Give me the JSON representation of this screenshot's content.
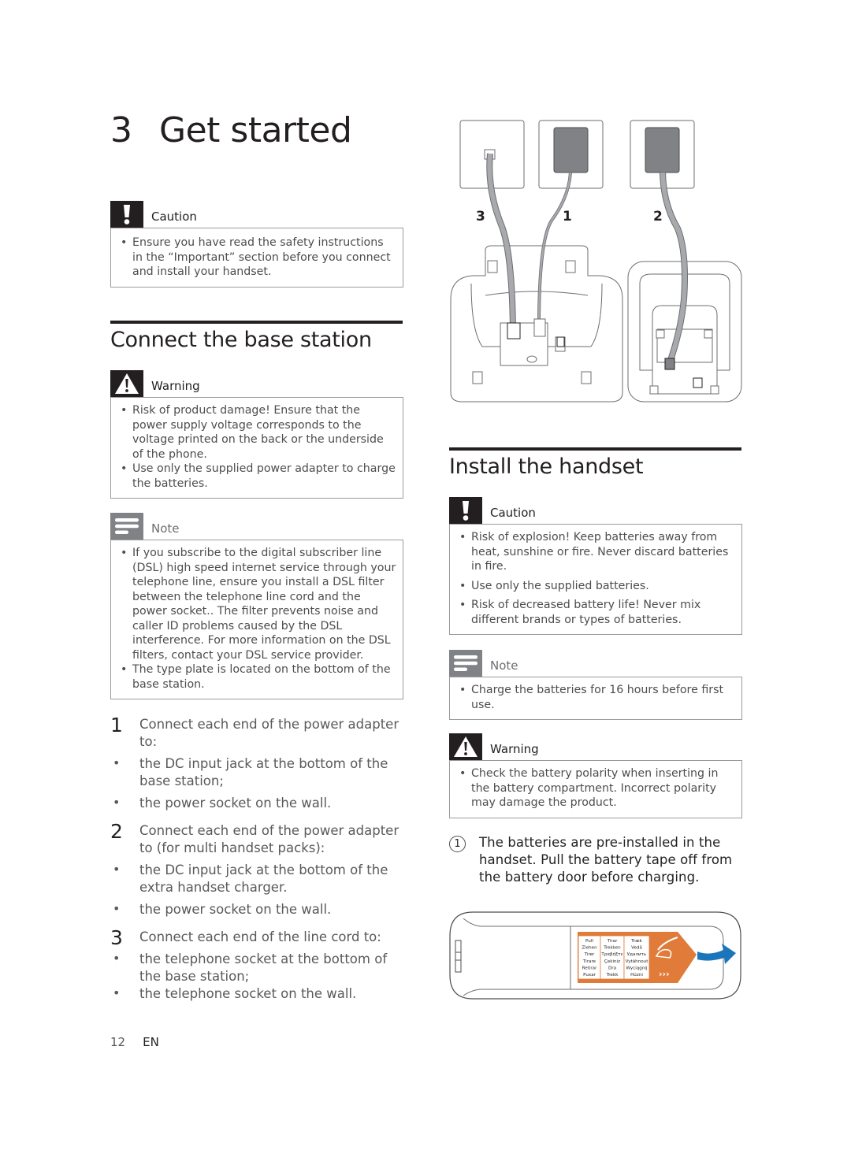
{
  "page": {
    "chapter_number": "3",
    "chapter_title": "Get started",
    "footer": {
      "page_number": "12",
      "language": "EN"
    }
  },
  "left_column": {
    "intro_caution": {
      "label": "Caution",
      "icon": "exclamation-icon",
      "items": [
        "Ensure you have read the safety instructions in the “Important” section before you connect and install your handset."
      ]
    },
    "section": {
      "title": "Connect the base station",
      "warning": {
        "label": "Warning",
        "icon": "warning-triangle-icon",
        "items": [
          "Risk of product damage! Ensure that the power supply voltage corresponds to the voltage printed on the back or the underside of the phone.",
          "Use only the supplied power adapter to charge the batteries."
        ]
      },
      "note": {
        "label": "Note",
        "icon": "note-lines-icon",
        "items": [
          "If you subscribe to the digital subscriber line (DSL) high speed internet service through your telephone line, ensure you install a DSL filter between the telephone line cord and the power socket.. The filter prevents noise and caller ID problems caused by the DSL interference. For more information on the DSL filters, contact your DSL service provider.",
          "The type plate is located on the bottom of the base station."
        ]
      },
      "steps": [
        {
          "number": "1",
          "text": "Connect each end of the power adapter to:",
          "bullets": [
            "the DC input jack at the bottom of the base station;",
            "the power socket on the wall."
          ]
        },
        {
          "number": "2",
          "text": "Connect each end of the power adapter to (for multi handset packs):",
          "bullets": [
            "the DC input jack at the bottom of the extra handset charger.",
            "the power socket on the wall."
          ]
        },
        {
          "number": "3",
          "text": "Connect each end of the line cord to:",
          "bullets": [
            "the telephone socket at the bottom of the base station;",
            "the telephone socket on the wall."
          ]
        }
      ]
    }
  },
  "right_column": {
    "connection_figure": {
      "labels": [
        "3",
        "1",
        "2"
      ],
      "description": "Wall sockets connected by cords to base station and charger"
    },
    "section": {
      "title": "Install the handset",
      "caution": {
        "label": "Caution",
        "icon": "exclamation-icon",
        "items": [
          "Risk of explosion! Keep batteries away from heat, sunshine or fire. Never discard batteries in fire.",
          "Use only the supplied batteries.",
          "Risk of decreased battery life! Never mix different brands or types of batteries."
        ]
      },
      "note": {
        "label": "Note",
        "icon": "note-lines-icon",
        "items": [
          "Charge the batteries for 16 hours before first use."
        ]
      },
      "warning": {
        "label": "Warning",
        "icon": "warning-triangle-icon",
        "items": [
          "Check the battery polarity when inserting in the battery compartment. Incorrect polarity may damage the product."
        ]
      },
      "step": {
        "number": "1",
        "text": "The batteries are pre-installed in the handset. Pull the battery tape off from the battery door before charging."
      },
      "battery_figure": {
        "tape_columns": [
          [
            "Pull",
            "Ziehen",
            "Tirer",
            "Tirare",
            "Retirar",
            "Puxar"
          ],
          [
            "Tirar",
            "Trekken",
            "Τραβήξτε",
            "Çekiniz",
            "Dra",
            "Trekk"
          ],
          [
            "Træk",
            "Vedä",
            "Удалить",
            "Vytáhnout",
            "Wyciągnij",
            "Húzni"
          ]
        ],
        "tape_color": "#e07b39",
        "arrow_color": "#1b75bb"
      }
    }
  }
}
